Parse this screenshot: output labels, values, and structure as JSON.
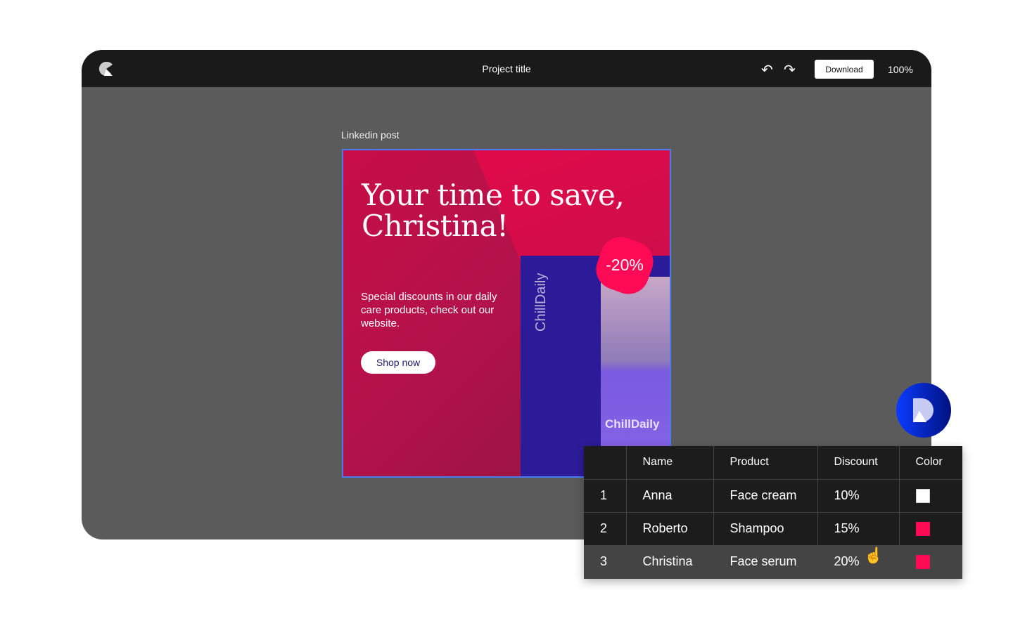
{
  "header": {
    "title": "Project title",
    "download_label": "Download",
    "zoom": "100%"
  },
  "canvas": {
    "frame_label": "Linkedin post"
  },
  "post": {
    "headline_line1": "Your time to save,",
    "headline_line2": "Christina!",
    "body": "Special discounts in our daily care products, check out our website.",
    "cta": "Shop now",
    "badge": "-20%",
    "brand_box": "ChillDaily",
    "brand_bottle": "ChillDaily"
  },
  "table": {
    "headers": [
      "",
      "Name",
      "Product",
      "Discount",
      "Color"
    ],
    "rows": [
      {
        "n": "1",
        "name": "Anna",
        "product": "Face cream",
        "discount": "10%",
        "color": "#ffffff"
      },
      {
        "n": "2",
        "name": "Roberto",
        "product": "Shampoo",
        "discount": "15%",
        "color": "#ff0a55"
      },
      {
        "n": "3",
        "name": "Christina",
        "product": "Face serum",
        "discount": "20%",
        "color": "#ff0a55"
      }
    ]
  }
}
